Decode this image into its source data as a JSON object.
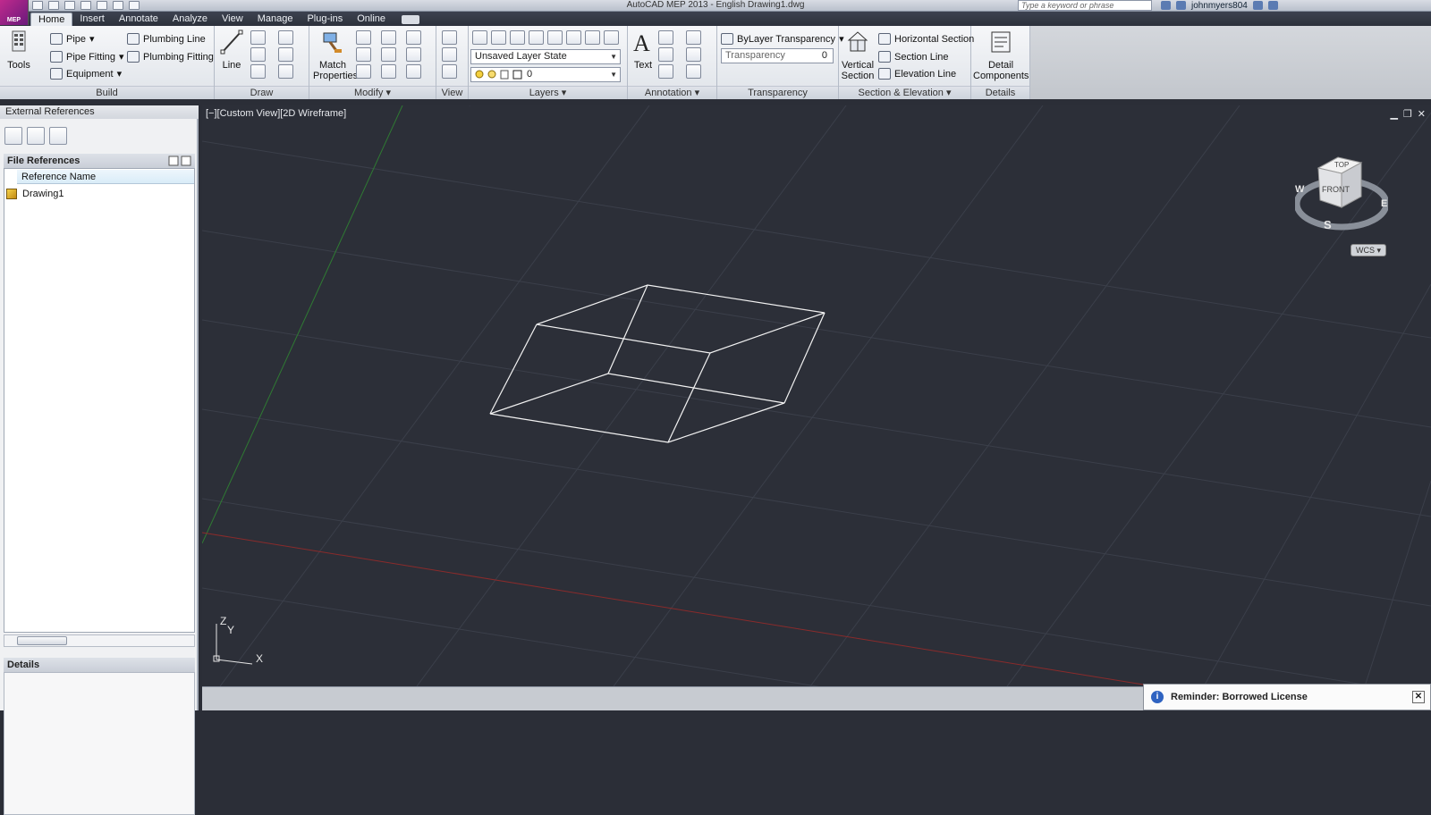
{
  "app": {
    "logo_text": "MEP",
    "title": "AutoCAD MEP 2013 - English    Drawing1.dwg",
    "search_placeholder": "Type a keyword or phrase",
    "username": "johnmyers804"
  },
  "tabs": [
    "Home",
    "Insert",
    "Annotate",
    "Analyze",
    "View",
    "Manage",
    "Plug-ins",
    "Online"
  ],
  "ribbon": {
    "build": {
      "title": "Build",
      "tools_label": "Tools",
      "pipe": "Pipe",
      "pipe_fitting": "Pipe Fitting",
      "equipment": "Equipment",
      "plumbing_line": "Plumbing Line",
      "plumbing_fitting": "Plumbing Fitting"
    },
    "draw": {
      "title": "Draw",
      "line_label": "Line"
    },
    "modify": {
      "title": "Modify",
      "match_label_1": "Match",
      "match_label_2": "Properties"
    },
    "view": {
      "title": "View"
    },
    "layers": {
      "title": "Layers",
      "layer_state": "Unsaved Layer State",
      "current_layer": "0"
    },
    "annotation": {
      "title": "Annotation",
      "text_label": "Text"
    },
    "transparency": {
      "title": "Transparency",
      "bylayer": "ByLayer Transparency",
      "field_label": "Transparency",
      "field_value": "0"
    },
    "section": {
      "title": "Section & Elevation",
      "vertical_1": "Vertical",
      "vertical_2": "Section",
      "horizontal": "Horizontal Section",
      "section_line": "Section Line",
      "elevation_line": "Elevation Line"
    },
    "details": {
      "title": "Details",
      "detail_1": "Detail",
      "detail_2": "Components"
    }
  },
  "palette": {
    "title": "External References",
    "file_references": "File References",
    "column_reference_name": "Reference Name",
    "references": [
      "Drawing1"
    ],
    "details": "Details"
  },
  "viewport": {
    "label": "[−][Custom View][2D Wireframe]",
    "viewcube_top": "TOP",
    "viewcube_front": "FRONT",
    "compass_w": "W",
    "compass_e": "E",
    "compass_s": "S",
    "wcs": "WCS",
    "axis_x": "X",
    "axis_y": "Y",
    "axis_z": "Z"
  },
  "notification": {
    "text": "Reminder: Borrowed License"
  },
  "colors": {
    "viewport_bg": "#2c2f38",
    "grid": "#3b3f4a",
    "x_axis": "#8a2b2b",
    "y_axis": "#2f7a33",
    "wire": "#f2f2f2"
  }
}
